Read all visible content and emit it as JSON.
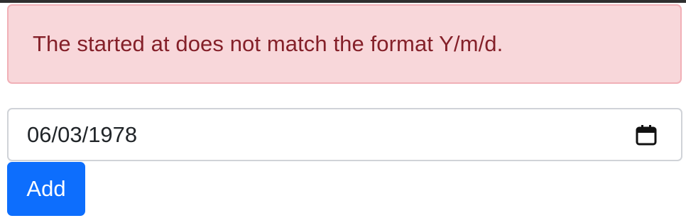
{
  "alert": {
    "message": "The started at does not match the format Y/m/d.",
    "background": "#f8d7da",
    "text_color": "#842029"
  },
  "date_input": {
    "value": "06/03/1978",
    "icon": "calendar-icon"
  },
  "add_button": {
    "label": "Add",
    "color": "#0d6efd"
  }
}
